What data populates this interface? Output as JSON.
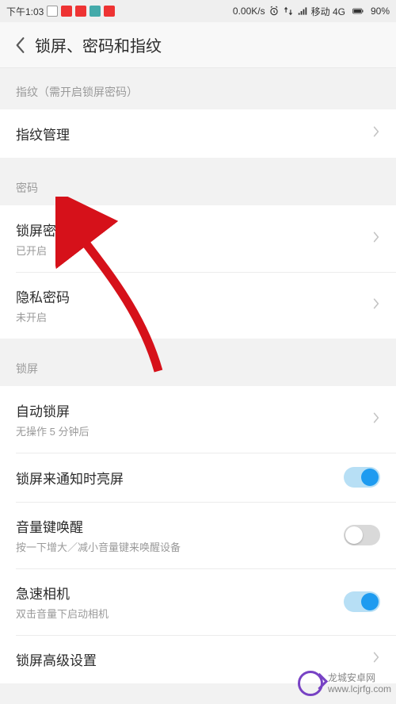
{
  "statusbar": {
    "time": "下午1:03",
    "net_speed": "0.00K/s",
    "carrier": "移动 4G",
    "battery_pct": "90%"
  },
  "header": {
    "title": "锁屏、密码和指纹"
  },
  "sections": {
    "fingerprint": {
      "header": "指纹（需开启锁屏密码）",
      "manage": "指纹管理"
    },
    "password": {
      "header": "密码",
      "lockscreen_pw": {
        "label": "锁屏密码",
        "status": "已开启"
      },
      "privacy_pw": {
        "label": "隐私密码",
        "status": "未开启"
      }
    },
    "lockscreen": {
      "header": "锁屏",
      "auto_lock": {
        "label": "自动锁屏",
        "status": "无操作 5 分钟后"
      },
      "wake_on_notify": "锁屏来通知时亮屏",
      "volume_wake": {
        "label": "音量键唤醒",
        "hint": "按一下增大／减小音量键来唤醒设备"
      },
      "quick_camera": {
        "label": "急速相机",
        "hint": "双击音量下启动相机"
      },
      "advanced": "锁屏高级设置"
    }
  },
  "watermark": {
    "line1": "龙城安卓网",
    "line2": "www.lcjrfg.com"
  },
  "toggles": {
    "wake_on_notify": true,
    "volume_wake": false,
    "quick_camera": true
  }
}
